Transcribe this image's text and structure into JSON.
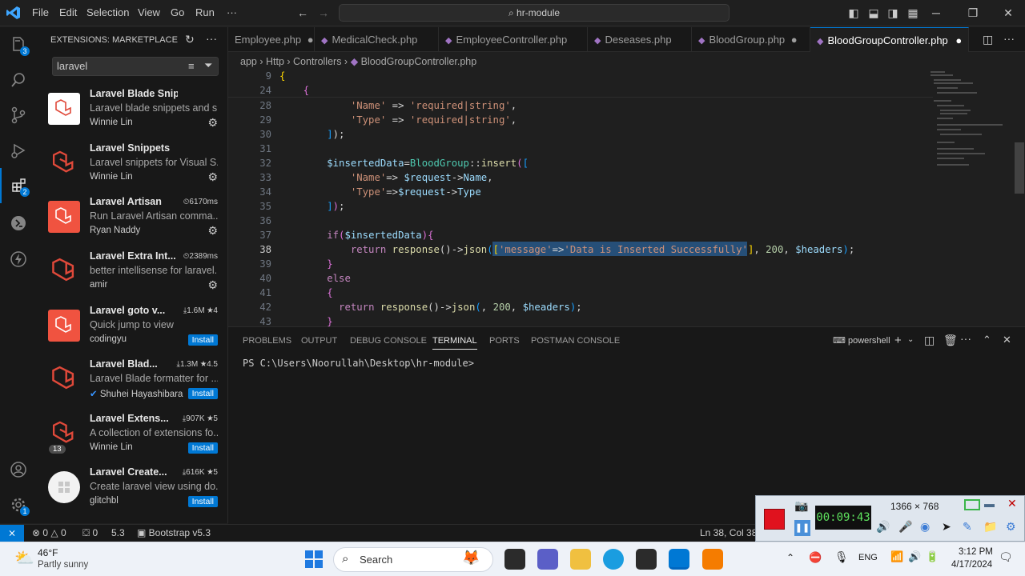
{
  "titlebar": {
    "menu": [
      "File",
      "Edit",
      "Selection",
      "View",
      "Go",
      "Run",
      "···"
    ],
    "search_text": "hr-module"
  },
  "activity": {
    "explorer_badge": "3",
    "extensions_badge": "2",
    "manage_badge": "1"
  },
  "sidebar": {
    "header": "EXTENSIONS: MARKETPLACE",
    "search_value": "laravel",
    "extensions": [
      {
        "name": "Laravel Blade Snippets",
        "desc": "Laravel blade snippets and s...",
        "author": "Winnie Lin",
        "meta": "",
        "action": "gear"
      },
      {
        "name": "Laravel Snippets",
        "desc": "Laravel snippets for Visual S...",
        "author": "Winnie Lin",
        "meta": "",
        "action": "gear"
      },
      {
        "name": "Laravel Artisan",
        "desc": "Run Laravel Artisan comma...",
        "author": "Ryan Naddy",
        "meta": "⏲6170ms",
        "action": "gear"
      },
      {
        "name": "Laravel Extra Int...",
        "desc": "better intellisense for laravel...",
        "author": "amir",
        "meta": "⏲2389ms",
        "action": "gear"
      },
      {
        "name": "Laravel goto v...",
        "desc": "Quick jump to view",
        "author": "codingyu",
        "meta": "⤓1.6M ★4",
        "action": "Install"
      },
      {
        "name": "Laravel Blad...",
        "desc": "Laravel Blade formatter for ...",
        "author": "Shuhei Hayashibara",
        "meta": "⤓1.3M ★4.5",
        "action": "Install"
      },
      {
        "name": "Laravel Extens...",
        "desc": "A collection of extensions fo...",
        "author": "Winnie Lin",
        "meta": "⤓907K ★5",
        "action": "Install",
        "count": "13"
      },
      {
        "name": "Laravel Create...",
        "desc": "Create laravel view using do...",
        "author": "glitchbl",
        "meta": "⤓616K ★5",
        "action": "Install"
      }
    ]
  },
  "tabs": [
    {
      "label": "Employee.php",
      "dot": true
    },
    {
      "label": "MedicalCheck.php",
      "dot": false
    },
    {
      "label": "EmployeeController.php",
      "dot": false
    },
    {
      "label": "Deseases.php",
      "dot": false
    },
    {
      "label": "BloodGroup.php",
      "dot": true
    },
    {
      "label": "BloodGroupController.php",
      "dot": true,
      "active": true
    }
  ],
  "breadcrumb": [
    "app",
    "Http",
    "Controllers",
    "BloodGroupController.php"
  ],
  "editor": {
    "lines": [
      "9",
      "24",
      "28",
      "29",
      "30",
      "31",
      "32",
      "33",
      "34",
      "35",
      "36",
      "37",
      "38",
      "39",
      "40",
      "41",
      "42",
      "43"
    ]
  },
  "panel": {
    "tabs": [
      "PROBLEMS",
      "OUTPUT",
      "DEBUG CONSOLE",
      "TERMINAL",
      "PORTS",
      "POSTMAN CONSOLE"
    ],
    "shell": "powershell",
    "prompt": "PS C:\\Users\\Noorullah\\Desktop\\hr-module>"
  },
  "status": {
    "errors": "0",
    "warnings": "0",
    "ports": "0",
    "version": "5.3",
    "bootstrap": "Bootstrap v5.3",
    "position": "Ln 38, Col 38"
  },
  "recorder": {
    "timer": "00:09:43",
    "resolution": "1366 × 768"
  },
  "taskbar": {
    "weather_temp": "46°F",
    "weather_desc": "Partly sunny",
    "search": "Search",
    "lang": "ENG",
    "time": "3:12 PM",
    "date": "4/17/2024"
  }
}
